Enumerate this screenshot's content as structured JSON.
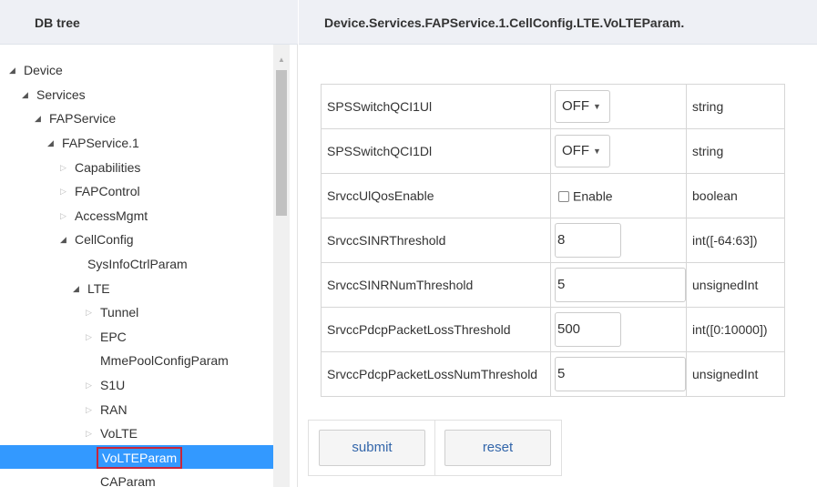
{
  "left": {
    "header": "DB tree",
    "tree": [
      {
        "label": "Device",
        "level": 0,
        "toggle": "open"
      },
      {
        "label": "Services",
        "level": 1,
        "toggle": "open"
      },
      {
        "label": "FAPService",
        "level": 2,
        "toggle": "open"
      },
      {
        "label": "FAPService.1",
        "level": 3,
        "toggle": "open"
      },
      {
        "label": "Capabilities",
        "level": 4,
        "toggle": "closed"
      },
      {
        "label": "FAPControl",
        "level": 4,
        "toggle": "closed"
      },
      {
        "label": "AccessMgmt",
        "level": 4,
        "toggle": "closed"
      },
      {
        "label": "CellConfig",
        "level": 4,
        "toggle": "open"
      },
      {
        "label": "SysInfoCtrlParam",
        "level": 5,
        "toggle": "none"
      },
      {
        "label": "LTE",
        "level": 5,
        "toggle": "open"
      },
      {
        "label": "Tunnel",
        "level": 6,
        "toggle": "closed"
      },
      {
        "label": "EPC",
        "level": 6,
        "toggle": "closed"
      },
      {
        "label": "MmePoolConfigParam",
        "level": 6,
        "toggle": "none"
      },
      {
        "label": "S1U",
        "level": 6,
        "toggle": "closed"
      },
      {
        "label": "RAN",
        "level": 6,
        "toggle": "closed"
      },
      {
        "label": "VoLTE",
        "level": 6,
        "toggle": "closed"
      },
      {
        "label": "VoLTEParam",
        "level": 6,
        "toggle": "none",
        "selected": true
      },
      {
        "label": "CAParam",
        "level": 6,
        "toggle": "none"
      }
    ]
  },
  "right": {
    "header": "Device.Services.FAPService.1.CellConfig.LTE.VoLTEParam.",
    "params": [
      {
        "name": "SPSSwitchQCI1Ul",
        "control": "select",
        "value": "OFF",
        "type": "string"
      },
      {
        "name": "SPSSwitchQCI1Dl",
        "control": "select",
        "value": "OFF",
        "type": "string"
      },
      {
        "name": "SrvccUlQosEnable",
        "control": "checkbox",
        "value": "Enable",
        "checked": false,
        "type": "boolean"
      },
      {
        "name": "SrvccSINRThreshold",
        "control": "input-short",
        "value": "8",
        "type": "int([-64:63])"
      },
      {
        "name": "SrvccSINRNumThreshold",
        "control": "input-long",
        "value": "5",
        "type": "unsignedInt"
      },
      {
        "name": "SrvccPdcpPacketLossThreshold",
        "control": "input-short",
        "value": "500",
        "type": "int([0:10000])"
      },
      {
        "name": "SrvccPdcpPacketLossNumThreshold",
        "control": "input-long",
        "value": "5",
        "type": "unsignedInt"
      }
    ],
    "buttons": {
      "submit": "submit",
      "reset": "reset"
    }
  },
  "colors": {
    "selected_bg": "#3399ff",
    "selected_outline": "#c8263a",
    "header_bg": "#eef0f5",
    "button_text": "#3366aa"
  }
}
